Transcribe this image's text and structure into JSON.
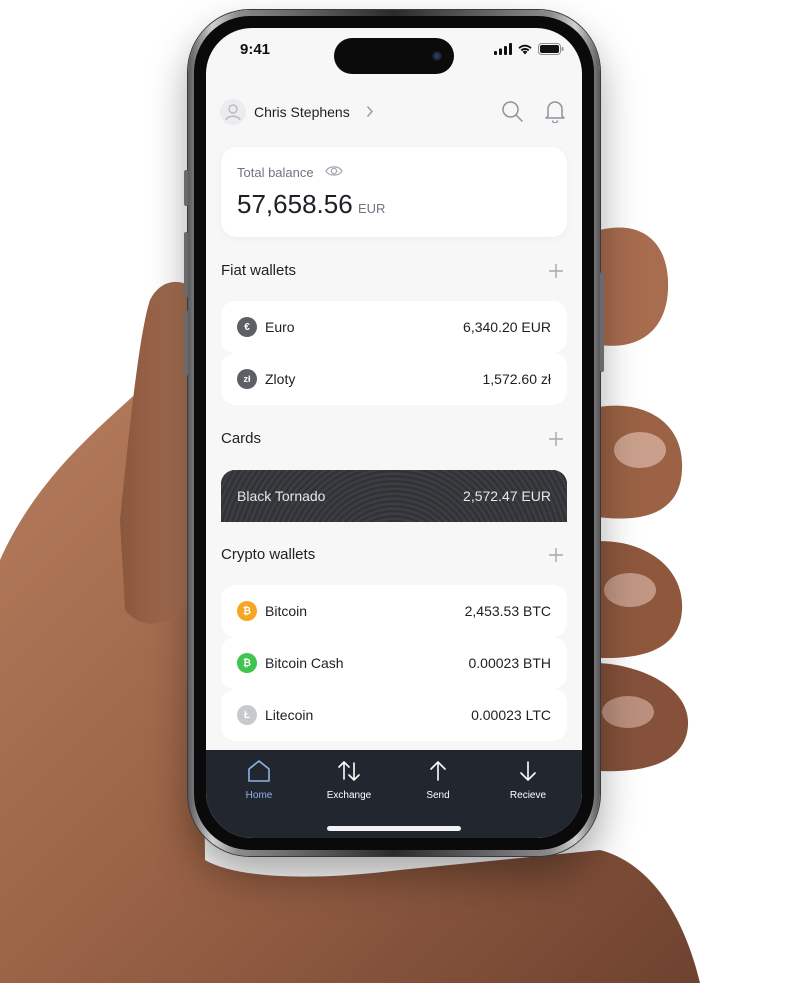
{
  "status": {
    "time": "9:41"
  },
  "user": {
    "name": "Chris Stephens"
  },
  "balance": {
    "label": "Total balance",
    "amount": "57,658.56",
    "currency": "EUR"
  },
  "sections": {
    "fiat": "Fiat wallets",
    "cards": "Cards",
    "crypto": "Crypto wallets"
  },
  "fiat_wallets": [
    {
      "symbol": "€",
      "name": "Euro",
      "amount": "6,340.20 EUR",
      "color": "#5c5f66"
    },
    {
      "symbol": "zł",
      "name": "Zloty",
      "amount": "1,572.60 zł",
      "color": "#5c5f66"
    }
  ],
  "cards": [
    {
      "name": "Black Tornado",
      "amount": "2,572.47 EUR"
    }
  ],
  "crypto_wallets": [
    {
      "symbol": "₿",
      "name": "Bitcoin",
      "amount": "2,453.53 BTC",
      "color": "#f5a623"
    },
    {
      "symbol": "₿",
      "name": "Bitcoin Cash",
      "amount": "0.00023 BTH",
      "color": "#3ec44f"
    },
    {
      "symbol": "Ł",
      "name": "Litecoin",
      "amount": "0.00023 LTC",
      "color": "#c7c9cc"
    }
  ],
  "tabs": [
    {
      "label": "Home",
      "icon": "home-icon",
      "active": true
    },
    {
      "label": "Exchange",
      "icon": "exchange-icon",
      "active": false
    },
    {
      "label": "Send",
      "icon": "arrow-up-icon",
      "active": false
    },
    {
      "label": "Recieve",
      "icon": "arrow-down-icon",
      "active": false
    }
  ],
  "colors": {
    "accent": "#8fb3e8",
    "tabbar": "#22262e",
    "background": "#f7f7f8"
  }
}
